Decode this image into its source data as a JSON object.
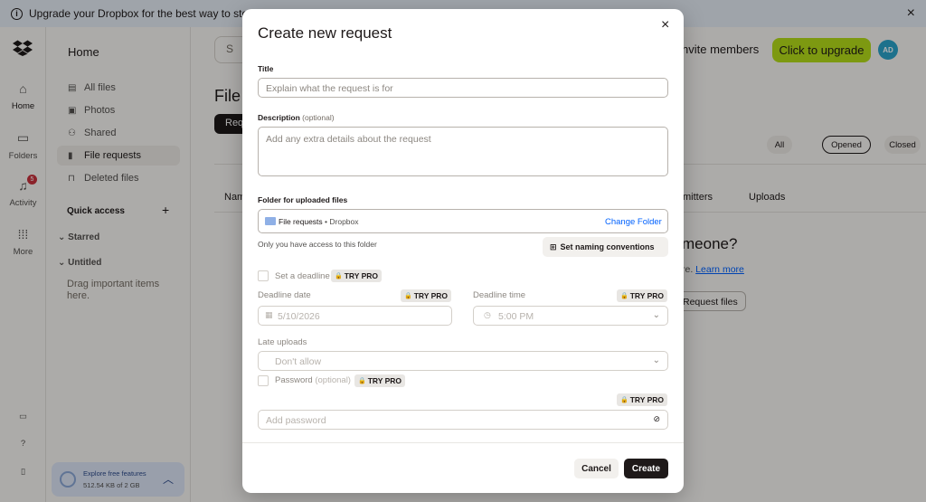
{
  "banner": {
    "text": "Upgrade your Dropbox for the best way to store, sha",
    "close_icon": "×"
  },
  "rail": {
    "home": "Home",
    "folders": "Folders",
    "activity": "Activity",
    "activity_badge": "5",
    "more": "More"
  },
  "sidenav": {
    "title": "Home",
    "items": [
      {
        "label": "All files",
        "icon": "folder-icon"
      },
      {
        "label": "Photos",
        "icon": "photo-icon"
      },
      {
        "label": "Shared",
        "icon": "shared-icon"
      },
      {
        "label": "File requests",
        "icon": "file-request-icon"
      },
      {
        "label": "Deleted files",
        "icon": "trash-icon"
      }
    ],
    "quick_access": "Quick access",
    "starred": "Starred",
    "untitled": "Untitled",
    "drag_hint": "Drag important items here.",
    "explore_title": "Explore free features",
    "explore_storage": "512.54 KB of 2 GB"
  },
  "header": {
    "search_icon": "S",
    "invite": "nvite members",
    "upgrade": "Click to upgrade",
    "avatar": "AD"
  },
  "main": {
    "title": "File",
    "black_button": "Req",
    "filters": {
      "all": "All",
      "opened": "Opened",
      "closed": "Closed"
    },
    "columns": {
      "name": "Nam",
      "submitters": "mitters",
      "uploads": "Uploads"
    },
    "empty_title": "meone?",
    "learn_prefix": "re. ",
    "learn_link": "Learn more",
    "request_files": "Request files"
  },
  "modal": {
    "title": "Create new request",
    "close_icon": "×",
    "title_label": "Title",
    "title_placeholder": "Explain what the request is for",
    "description_label": "Description",
    "description_optional": "(optional)",
    "description_placeholder": "Add any extra details about the request",
    "folder_label": "Folder for uploaded files",
    "folder_name": "File requests",
    "folder_sep": " • ",
    "folder_parent": "Dropbox",
    "change_folder": "Change Folder",
    "access_hint": "Only you have access to this folder",
    "naming": "Set naming conventions",
    "deadline_checkbox": "Set a deadline",
    "try_pro": "TRY PRO",
    "deadline_date_label": "Deadline date",
    "deadline_date_value": "5/10/2026",
    "deadline_time_label": "Deadline time",
    "deadline_time_value": "5:00 PM",
    "late_uploads_label": "Late uploads",
    "late_uploads_value": "Don't allow",
    "password_label": "Password",
    "password_optional": "(optional)",
    "password_placeholder": "Add password",
    "cancel": "Cancel",
    "create": "Create"
  },
  "colors": {
    "accent_blue": "#0061fe",
    "upgrade_green": "#b4dc19",
    "primary_dark": "#1e1919",
    "avatar_teal": "#2aa3c9",
    "badge_red": "#c8323d"
  }
}
